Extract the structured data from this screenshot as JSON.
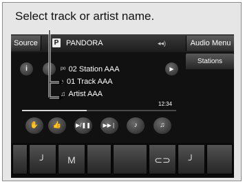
{
  "caption": "Select track or artist name.",
  "topbar": {
    "source_label": "Source",
    "pandora_logo": "P",
    "pandora_title": "PANDORA",
    "volume_glyph": "◂◂)",
    "audio_menu_label": "Audio Menu"
  },
  "stations_label": "Stations",
  "info_label": "i",
  "now_playing": {
    "station": "02 Station AAA",
    "track": "01 Track AAA",
    "artist": "Artist AAA"
  },
  "play_glyph": "▶",
  "time_label": "12:34",
  "progress_fraction": 0.42,
  "controls": [
    "thumbs-down-icon",
    "thumbs-up-icon",
    "play-pause-icon",
    "skip-icon",
    "bookmark-song-icon",
    "bookmark-artist-icon"
  ],
  "control_glyphs": {
    "thumbs_down": "✋",
    "thumbs_up": "👍",
    "play_pause": "▶/❚❚",
    "skip": "▶▶❘",
    "bookmark_song": "♪",
    "bookmark_artist": "♫"
  },
  "bottom_glyphs": {
    "seat_left": "╯",
    "mode": "M",
    "car": "⊂⊃",
    "seat_right": "╯"
  }
}
